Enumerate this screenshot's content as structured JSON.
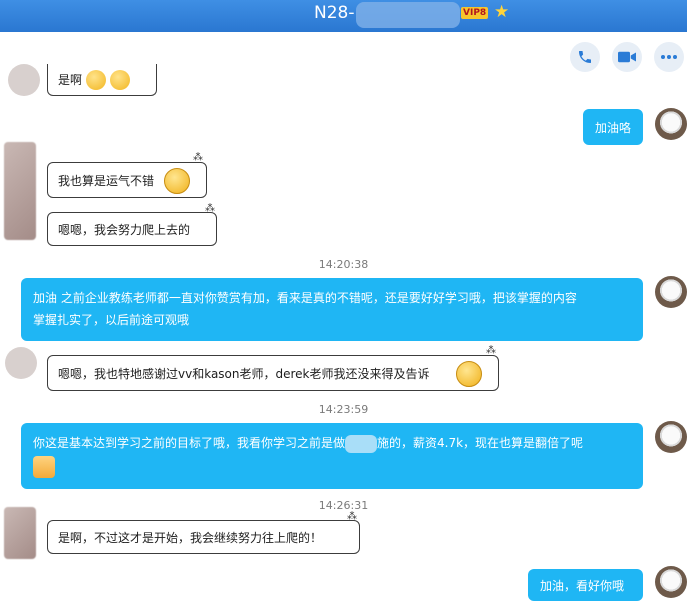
{
  "window": {
    "title": "N28-",
    "vip_badge": "VIP8"
  },
  "toolbar": {
    "phone": "phone-icon",
    "video": "video-icon",
    "more": "more-icon"
  },
  "messages": {
    "m0": "是啊",
    "m1": "加油咯",
    "m2": "我也算是运气不错",
    "m3": "嗯嗯，我会努力爬上去的",
    "t1": "14:20:38",
    "m4a": "加油  之前企业教练老师都一直对你赞赏有加，看来是真的不错呢，还是要好好学习哦，把该掌握的内容",
    "m4b": "掌握扎实了，以后前途可观哦",
    "m5": "嗯嗯，我也特地感谢过vv和kason老师，derek老师我还没来得及告诉",
    "t2": "14:23:59",
    "m6a": "你这是基本达到学习之前的目标了哦，我看你学习之前是做",
    "m6b": "施的，薪资4.7k，现在也算是翻倍了呢",
    "t3": "14:26:31",
    "m7": "是啊，不过这才是开始，我会继续努力往上爬的！",
    "m8": "加油，看好你哦"
  },
  "colors": {
    "titlebar": "#2a77d1",
    "outgoing_bubble": "#1fb6f4",
    "incoming_border": "#3c3c3c"
  }
}
